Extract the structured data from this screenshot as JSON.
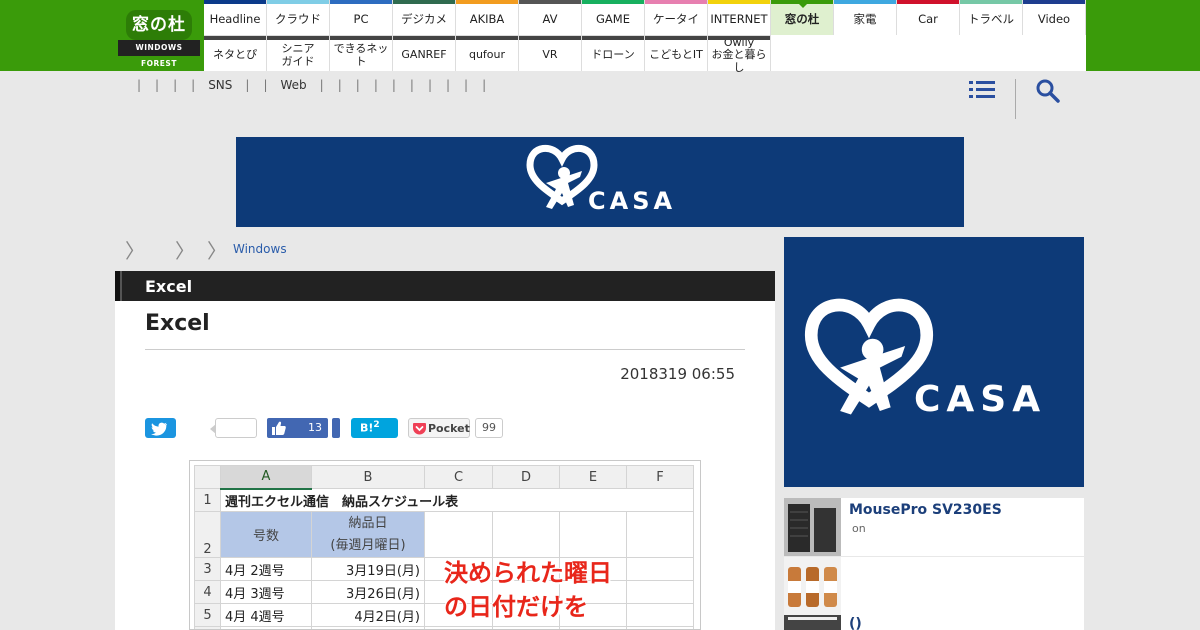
{
  "logo": {
    "top": "窓の杜",
    "bottom": "WINDOWS FOREST"
  },
  "nav": {
    "row1": [
      {
        "label": "Headline",
        "color": "#0b3a8a"
      },
      {
        "label": "クラウド",
        "color": "#7fcde6"
      },
      {
        "label": "PC",
        "color": "#2d6cc0"
      },
      {
        "label": "デジカメ",
        "color": "#2f6b4f"
      },
      {
        "label": "AKIBA",
        "color": "#f29c1f"
      },
      {
        "label": "AV",
        "color": "#555555"
      },
      {
        "label": "GAME",
        "color": "#17b05f"
      },
      {
        "label": "ケータイ",
        "color": "#e77fb0"
      },
      {
        "label": "INTERNET",
        "color": "#f2d20c"
      },
      {
        "label": "窓の杜",
        "color": "#3a9b0a"
      },
      {
        "label": "家電",
        "color": "#3ea8e0"
      },
      {
        "label": "Car",
        "color": "#d0112b"
      },
      {
        "label": "トラベル",
        "color": "#76c8a6"
      },
      {
        "label": "Video",
        "color": "#1e3d8f"
      }
    ],
    "row2": [
      "ネタとぴ",
      "シニア\nガイド",
      "できるネット",
      "GANREF",
      "qufour",
      "VR",
      "ドローン",
      "こどもとIT",
      "Owlly\nお金と暮らし"
    ]
  },
  "subnav": [
    "",
    "",
    "",
    "SNS",
    "",
    "Web",
    "",
    "",
    "",
    "",
    "",
    "",
    "",
    "",
    "",
    ""
  ],
  "top_ad": {
    "brand": "CASA"
  },
  "breadcrumb": {
    "link": "Windows"
  },
  "article": {
    "section": "Excel",
    "title": "Excel",
    "date": "2018319 06:55"
  },
  "share": {
    "facebook_count": "13",
    "hatena_label": "B!",
    "hatena_count": "2",
    "pocket_label": "Pocket",
    "pocket_count": "99"
  },
  "excel": {
    "col_headers": [
      "A",
      "B",
      "C",
      "D",
      "E",
      "F"
    ],
    "row1": "週刊エクセル通信　納品スケジュール表",
    "header_a": "号数",
    "header_b1": "納品日",
    "header_b2": "(毎週月曜日)",
    "rows": [
      {
        "n": "3",
        "a": "4月 2週号",
        "b": "3月19日(月)"
      },
      {
        "n": "4",
        "a": "4月 3週号",
        "b": "3月26日(月)"
      },
      {
        "n": "5",
        "a": "4月 4週号",
        "b": "4月2日(月)"
      }
    ],
    "callout1": "決められた曜日",
    "callout2": "の日付だけを"
  },
  "sidebar": {
    "ad_brand": "CASA",
    "items": [
      {
        "title": "MousePro SV230ES",
        "sub": "on"
      },
      {
        "title": "",
        "sub": ""
      },
      {
        "title": "()",
        "sub": ""
      }
    ]
  }
}
